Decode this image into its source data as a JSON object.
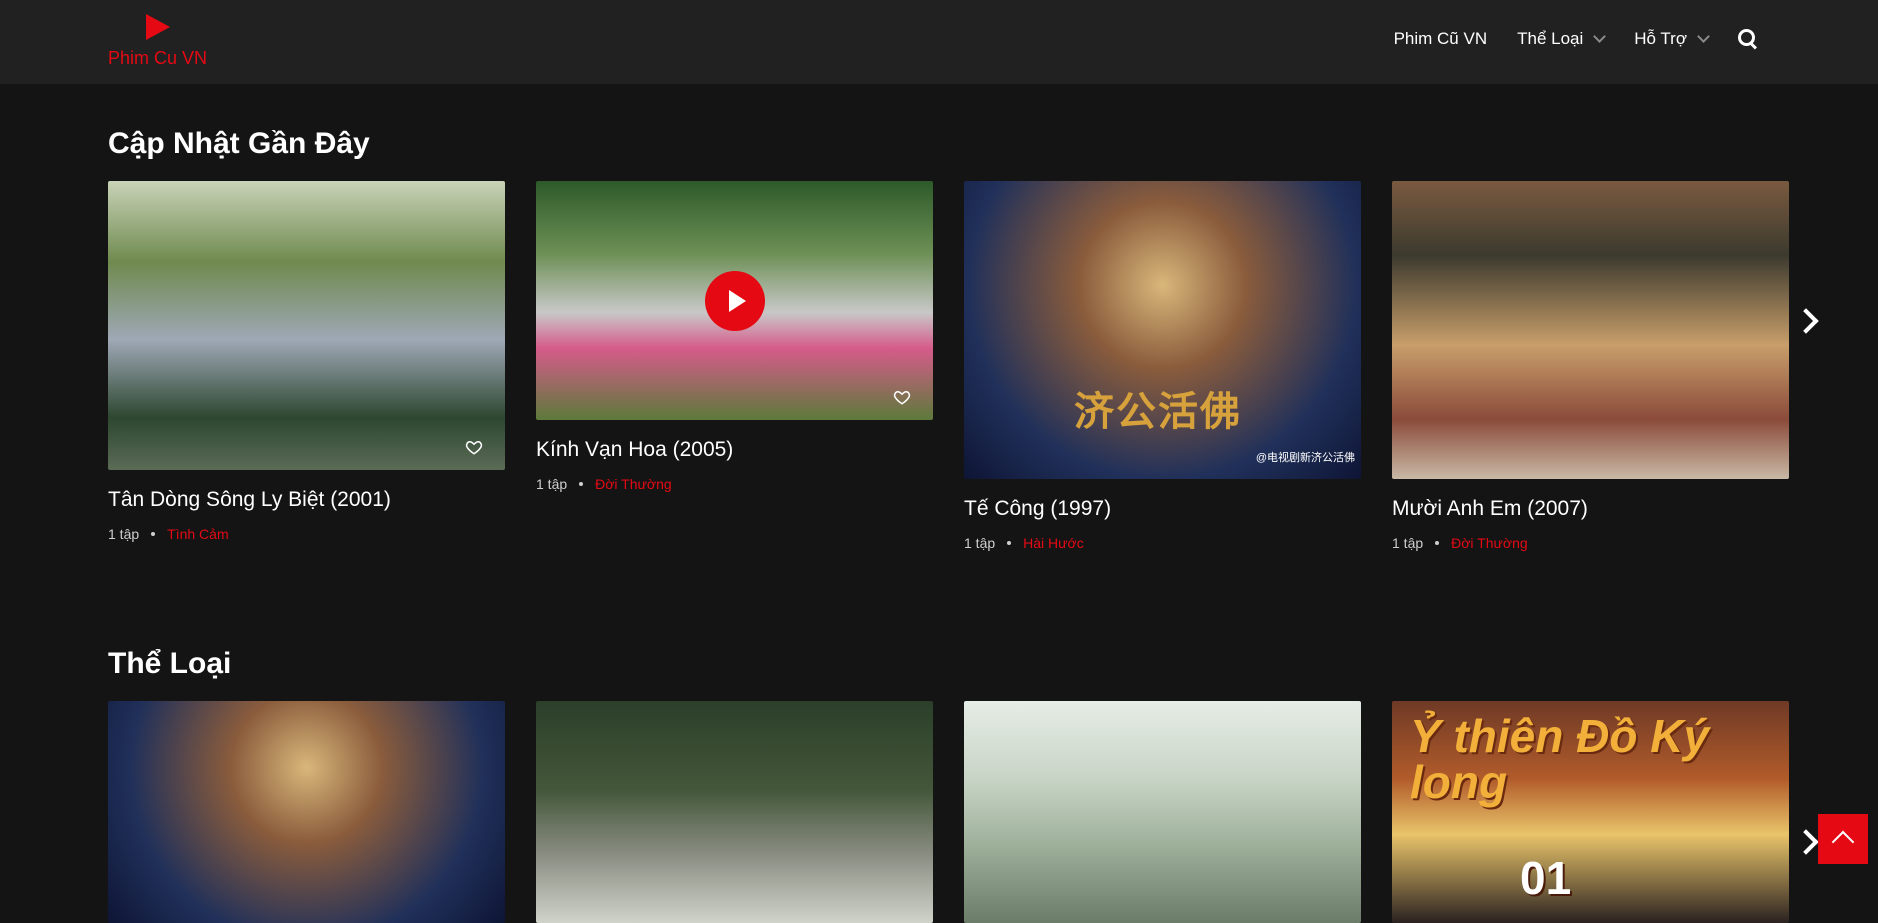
{
  "header": {
    "logo_text": "Phim Cu VN",
    "nav": [
      {
        "label": "Phim Cũ VN"
      },
      {
        "label": "Thể Loại"
      },
      {
        "label": "Hỗ Trợ"
      }
    ]
  },
  "sections": [
    {
      "title": "Cập Nhật Gần Đây",
      "cards": [
        {
          "title": "Tân Dòng Sông Ly Biệt (2001)",
          "episodes": "1 tập",
          "genre": "Tình Cảm"
        },
        {
          "title": "Kính Vạn Hoa (2005)",
          "episodes": "1 tập",
          "genre": "Đời Thường"
        },
        {
          "title": "Tế Công (1997)",
          "episodes": "1 tập",
          "genre": "Hài Hước",
          "poster_text": "济公活佛",
          "watermark": "@电视剧新济公活佛"
        },
        {
          "title": "Mười Anh Em (2007)",
          "episodes": "1 tập",
          "genre": "Đời Thường"
        }
      ]
    },
    {
      "title": "Thể Loại",
      "cards": [
        {},
        {},
        {},
        {
          "poster_logo": "Ỷ thiên Đồ Ký long",
          "poster_ep": "01"
        }
      ]
    }
  ],
  "colors": {
    "accent": "#e50914",
    "background": "#141414",
    "header_bg": "#212121"
  },
  "icons": [
    "play-icon",
    "heart-icon",
    "search-icon",
    "chevron-down-icon",
    "arrow-right-icon",
    "arrow-up-icon"
  ]
}
